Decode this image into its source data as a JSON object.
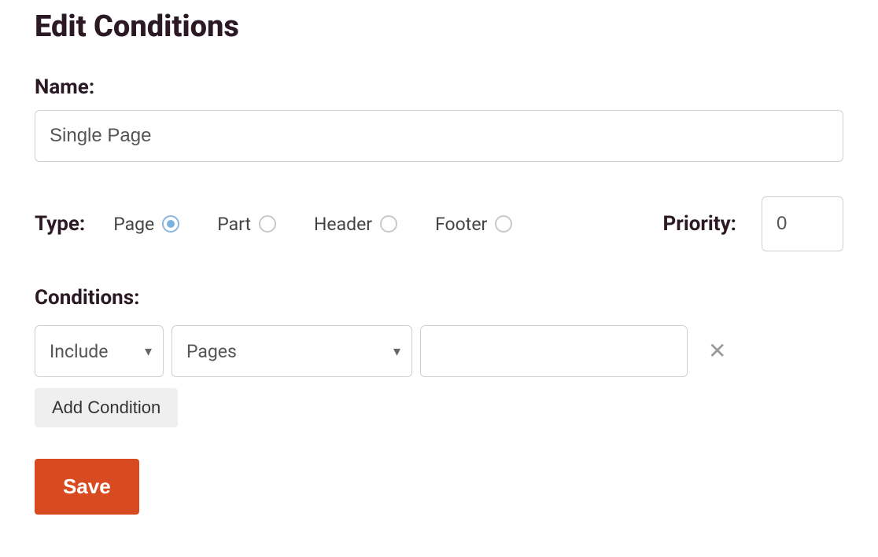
{
  "header": {
    "title": "Edit Conditions"
  },
  "name": {
    "label": "Name:",
    "value": "Single Page"
  },
  "type": {
    "label": "Type:",
    "options": [
      {
        "label": "Page",
        "selected": true
      },
      {
        "label": "Part",
        "selected": false
      },
      {
        "label": "Header",
        "selected": false
      },
      {
        "label": "Footer",
        "selected": false
      }
    ]
  },
  "priority": {
    "label": "Priority:",
    "value": "0"
  },
  "conditions": {
    "label": "Conditions:",
    "rows": [
      {
        "mode": "Include",
        "scope": "Pages",
        "value": ""
      }
    ],
    "add_label": "Add Condition"
  },
  "actions": {
    "save_label": "Save"
  }
}
